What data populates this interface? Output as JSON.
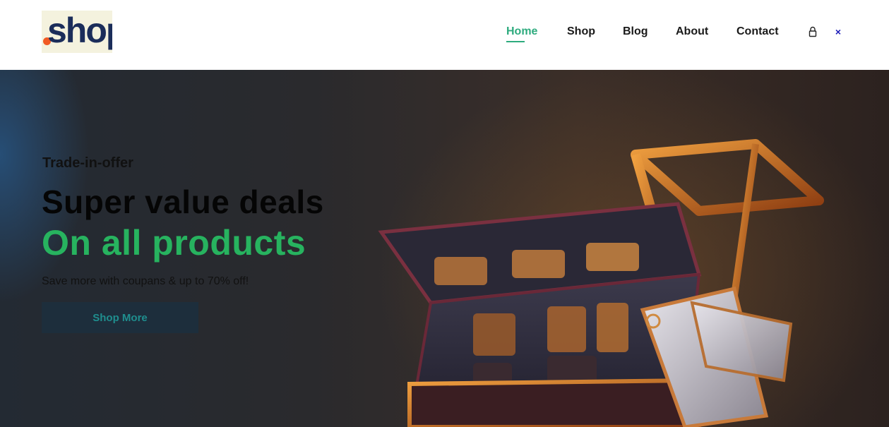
{
  "header": {
    "logo": {
      "text": "shop",
      "dot_color": "#f15a24",
      "text_color": "#1b2d5a"
    },
    "nav": [
      {
        "label": "Home",
        "active": true
      },
      {
        "label": "Shop",
        "active": false
      },
      {
        "label": "Blog",
        "active": false
      },
      {
        "label": "About",
        "active": false
      },
      {
        "label": "Contact",
        "active": false
      }
    ],
    "icons": {
      "cart": "lock-bag-icon",
      "close": "close-icon",
      "close_glyph": "×"
    }
  },
  "hero": {
    "tagline": "Trade-in-offer",
    "headline": "Super value deals",
    "subline": "On all products",
    "description": "Save more with coupans & up to 70% off!",
    "cta_label": "Shop More",
    "image": "shopping-cart-with-price-tags-illustration"
  },
  "colors": {
    "accent": "#2eab7e",
    "subline_green": "#27b35f",
    "cta_bg": "#1d2e3c",
    "cta_text": "#1f8e8e"
  }
}
